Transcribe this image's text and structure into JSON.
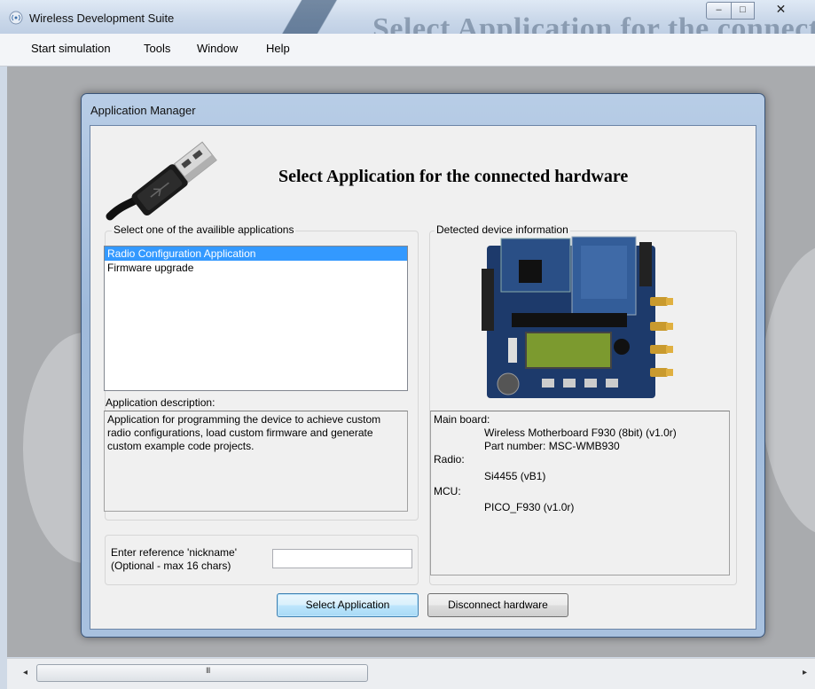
{
  "window": {
    "title": "Wireless Development Suite",
    "background_heading": "Select Application for the connected hardware",
    "controls": {
      "minimize": "–",
      "maximize": "□",
      "close": "✕"
    }
  },
  "menu": {
    "items": [
      "Start simulation",
      "Tools",
      "Window",
      "Help"
    ]
  },
  "dialog": {
    "title": "Application Manager",
    "headline": "Select Application for the connected hardware",
    "apps_group_label": "Select one of the availible applications",
    "applications": [
      "Radio Configuration Application",
      "Firmware upgrade"
    ],
    "selected_index": 0,
    "description_label": "Application description:",
    "description": "Application for programming the device to achieve custom radio configurations, load custom firmware and generate custom example code projects.",
    "nickname_label_1": "Enter reference 'nickname'",
    "nickname_label_2": "(Optional - max 16 chars)",
    "nickname_value": "",
    "device_group_label": "Detected device information",
    "device_info": {
      "main_board_label": "Main board:",
      "main_board_name": "Wireless Motherboard F930 (8bit) (v1.0r)",
      "part_number": "Part number: MSC-WMB930",
      "radio_label": "Radio:",
      "radio_value": "Si4455 (vB1)",
      "mcu_label": "MCU:",
      "mcu_value": "PICO_F930 (v1.0r)"
    },
    "buttons": {
      "select": "Select Application",
      "disconnect": "Disconnect hardware"
    }
  },
  "scrollbar": {
    "left_arrow": "◂",
    "right_arrow": "▸",
    "grip": "III"
  }
}
